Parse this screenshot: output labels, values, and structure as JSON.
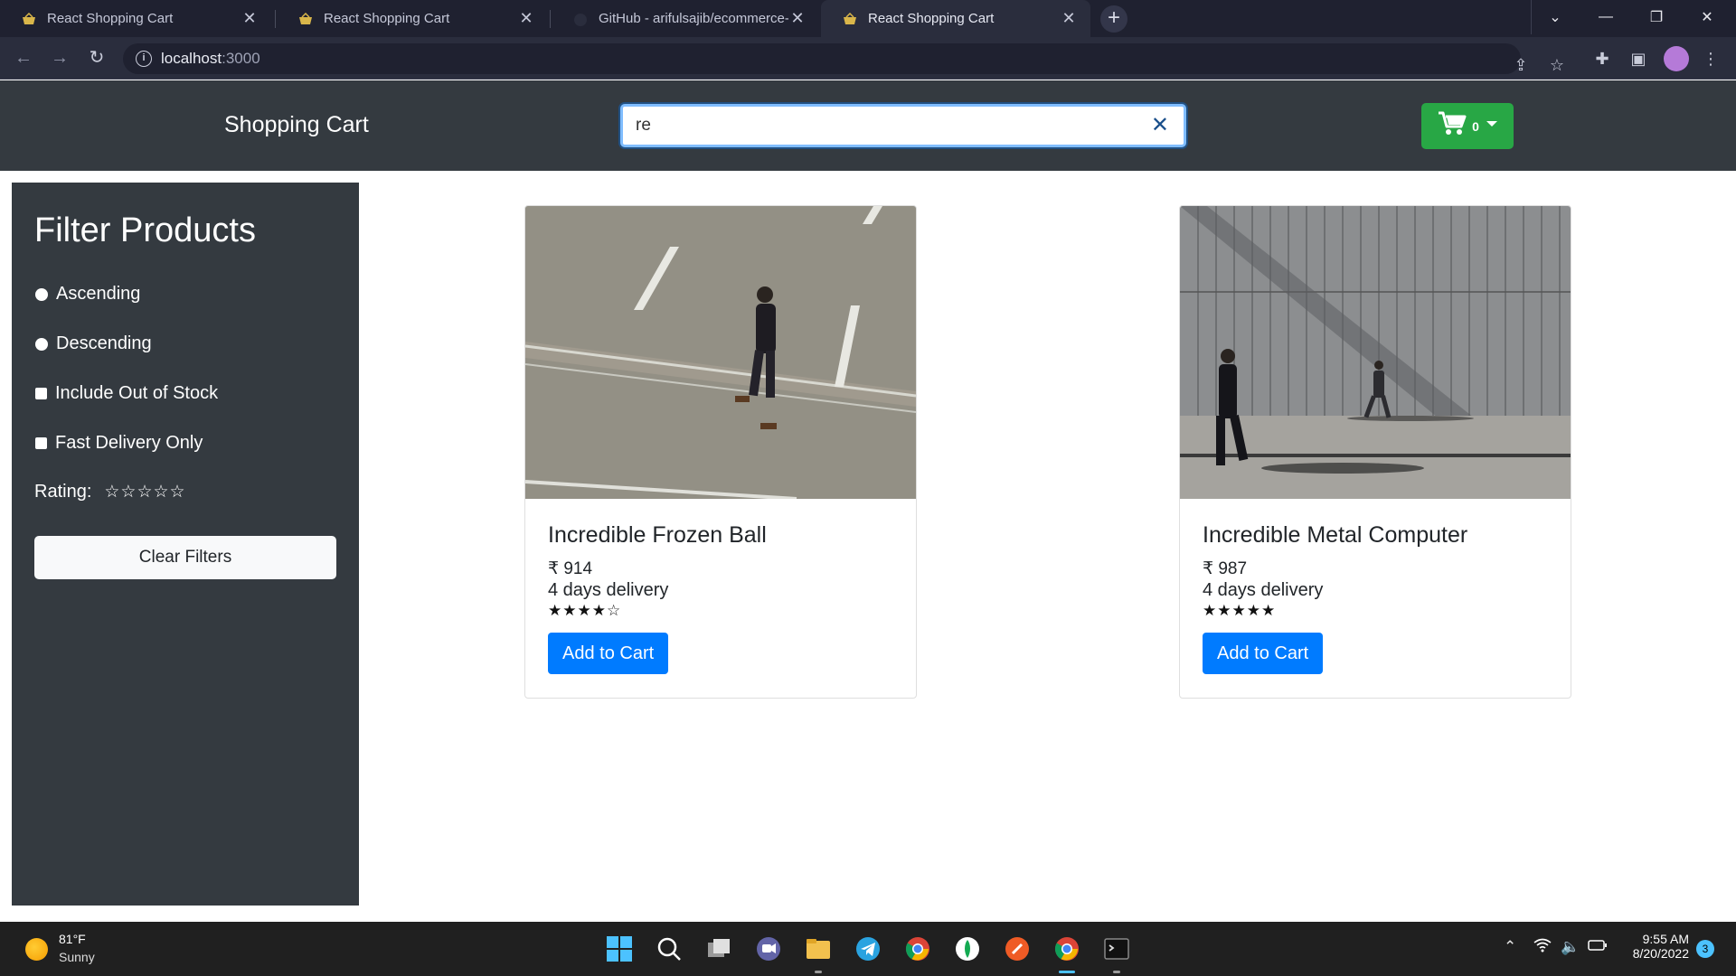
{
  "browser": {
    "tabs": [
      {
        "title": "React Shopping Cart",
        "active": false
      },
      {
        "title": "React Shopping Cart",
        "active": false
      },
      {
        "title": "GitHub - arifulsajib/ecommerce-",
        "active": false
      },
      {
        "title": "React Shopping Cart",
        "active": true
      }
    ],
    "url_host": "localhost",
    "url_port": ":3000"
  },
  "header": {
    "brand": "Shopping Cart",
    "search_value": "re",
    "cart_count": "0"
  },
  "sidebar": {
    "title": "Filter Products",
    "filters": [
      {
        "label": "Ascending",
        "type": "radio"
      },
      {
        "label": "Descending",
        "type": "radio"
      },
      {
        "label": "Include Out of Stock",
        "type": "checkbox"
      },
      {
        "label": "Fast Delivery Only",
        "type": "checkbox"
      }
    ],
    "rating_label": "Rating:",
    "rating_stars": "☆☆☆☆☆",
    "clear_label": "Clear Filters"
  },
  "products": [
    {
      "name": "Incredible Frozen Ball",
      "price": "₹ 914",
      "delivery": "4 days delivery",
      "stars": "★★★★☆",
      "rating": 4,
      "button": "Add to Cart"
    },
    {
      "name": "Incredible Metal Computer",
      "price": "₹ 987",
      "delivery": "4 days delivery",
      "stars": "★★★★★",
      "rating": 5,
      "button": "Add to Cart"
    }
  ],
  "taskbar": {
    "temperature": "81°F",
    "condition": "Sunny",
    "time": "9:55 AM",
    "date": "8/20/2022",
    "notification_count": "3"
  },
  "colors": {
    "navbar": "#343a40",
    "cart_button": "#28a745",
    "primary_button": "#007bff",
    "browser_tabbar": "#1f2130"
  }
}
